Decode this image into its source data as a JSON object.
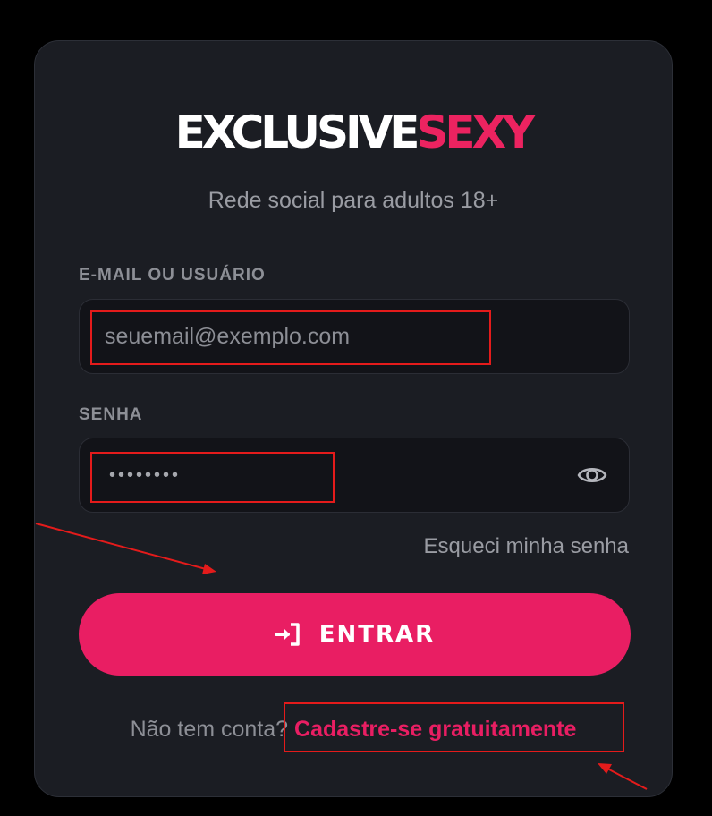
{
  "brand": {
    "name_part1": "EXCLUSIVE",
    "name_part2": "SEXY",
    "tagline": "Rede social para adultos 18+"
  },
  "form": {
    "email_label": "E-MAIL OU USUÁRIO",
    "email_placeholder": "seuemail@exemplo.com",
    "password_label": "SENHA",
    "password_mask": "••••••••",
    "forgot_link": "Esqueci minha senha",
    "submit_label": "ENTRAR"
  },
  "signup": {
    "prompt": "Não tem conta?",
    "link": "Cadastre-se gratuitamente"
  },
  "icons": {
    "eye": "eye-icon",
    "login": "login-arrow-icon"
  },
  "colors": {
    "accent": "#e91e63",
    "annotation": "#e41b1b",
    "card_bg": "#1b1d23",
    "input_bg": "#121318"
  }
}
